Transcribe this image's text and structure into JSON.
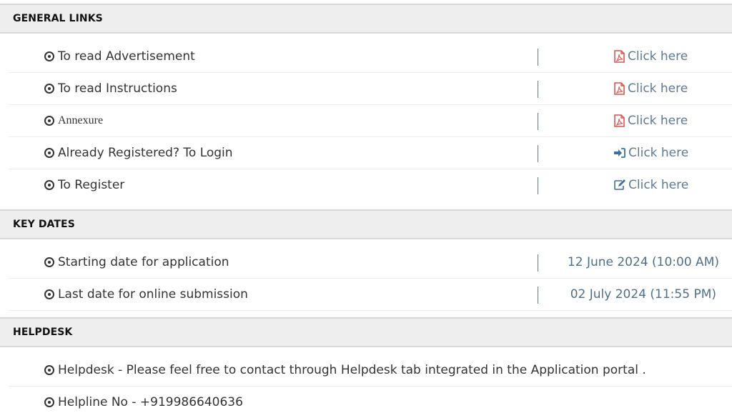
{
  "general_links": {
    "title": "GENERAL LINKS",
    "rows": [
      {
        "label": "To read Advertisement",
        "link": "Click here",
        "icon": "pdf-icon"
      },
      {
        "label": "To read Instructions",
        "link": "Click here",
        "icon": "pdf-icon"
      },
      {
        "label": "Annexure",
        "link": "Click here",
        "icon": "pdf-icon"
      },
      {
        "label": "Already Registered? To Login",
        "link": "Click here",
        "icon": "sign-in-icon"
      },
      {
        "label": "To Register",
        "link": "Click here",
        "icon": "edit-icon"
      }
    ]
  },
  "key_dates": {
    "title": "KEY DATES",
    "rows": [
      {
        "label": "Starting date for application",
        "value": "12 June 2024 (10:00 AM)"
      },
      {
        "label": "Last date for online submission",
        "value": "02 July 2024 (11:55 PM)"
      }
    ]
  },
  "helpdesk": {
    "title": "HELPDESK",
    "rows": [
      {
        "label": "Helpdesk - Please feel free to contact through Helpdesk tab integrated in the Application portal ."
      },
      {
        "label": "Helpline No - +919986640636"
      }
    ]
  },
  "colors": {
    "pdf_icon": "#d9534f",
    "link": "#5d7a96",
    "action_icon": "#3a6fa8",
    "header_bg": "#eeeeee"
  }
}
